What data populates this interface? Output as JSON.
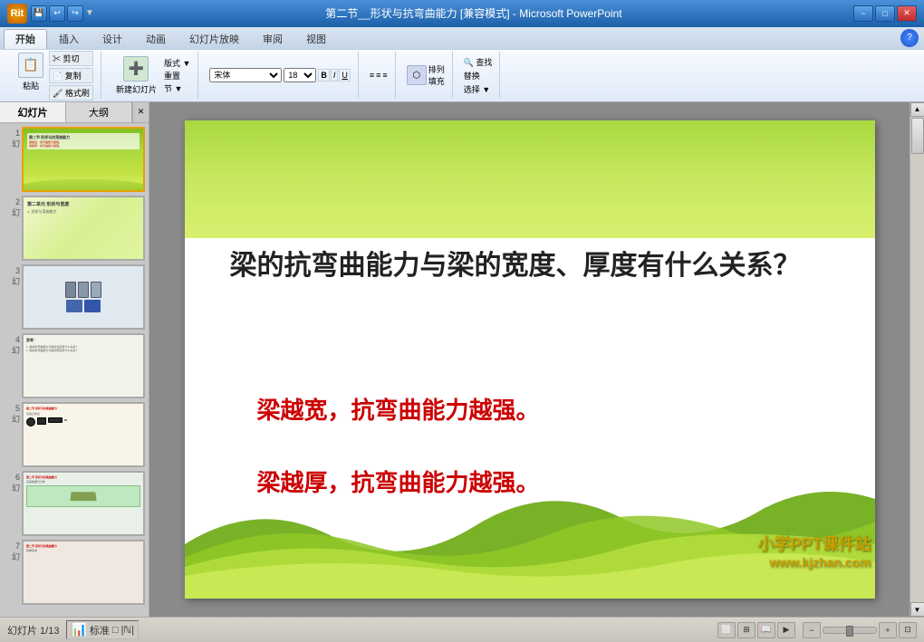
{
  "titlebar": {
    "title": "第二节__形状与抗弯曲能力 [兼容模式] - Microsoft PowerPoint",
    "logo": "O",
    "minimize": "−",
    "maximize": "□",
    "close": "✕"
  },
  "ribbon": {
    "tabs": [
      "开始",
      "插入",
      "设计",
      "动画",
      "幻灯片放映",
      "审阅",
      "视图"
    ],
    "active_tab": "开始"
  },
  "sidebar": {
    "tab1": "幻灯片",
    "tab2": "大纲",
    "slide_count": 7,
    "visible_slides": [
      1,
      2,
      3,
      4,
      5,
      6,
      7
    ]
  },
  "main_slide": {
    "question": "梁的抗弯曲能力与梁的宽度、厚度有什么关系？",
    "answer1": "梁越宽，抗弯曲能力越强。",
    "answer2": "梁越厚，抗弯曲能力越强。"
  },
  "statusbar": {
    "slide_info": "幻灯片 1/13",
    "theme": "标准",
    "zoom_controls": [
      "−",
      "口",
      "+"
    ],
    "zoom_level": "□ ",
    "view_icons": [
      "标准",
      "幻灯片浏览",
      "阅读视图",
      "幻灯片放映"
    ]
  },
  "watermark": {
    "line1": "小学PPT课件站",
    "line2": "www.kjzhan.com"
  }
}
